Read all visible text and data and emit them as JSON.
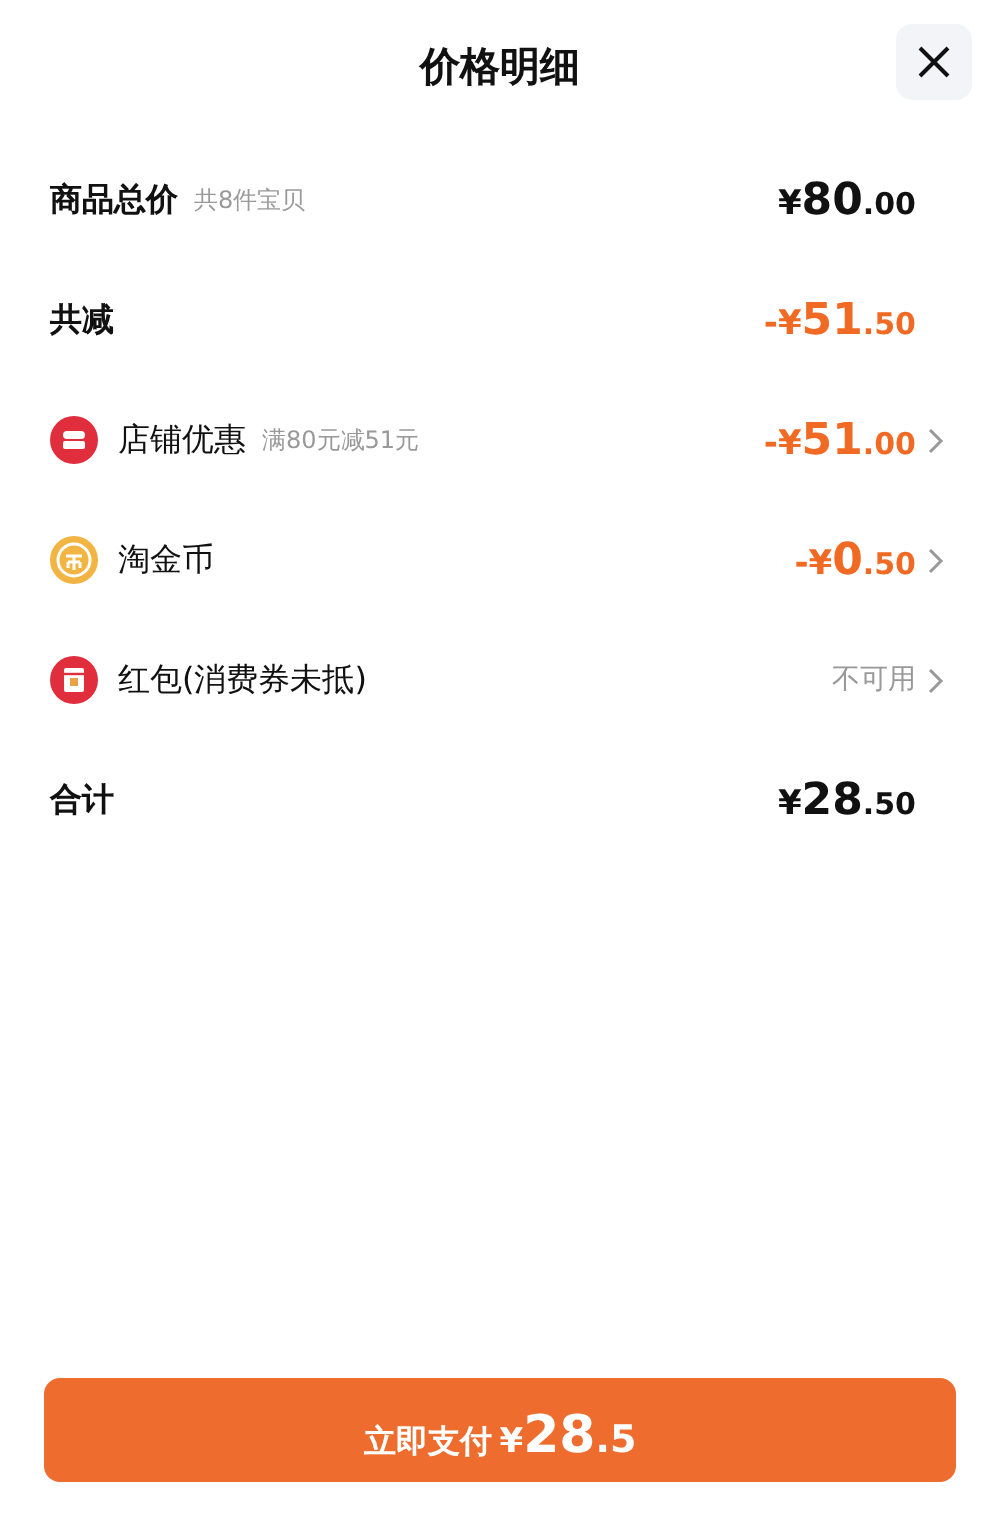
{
  "title": "价格明细",
  "rows": [
    {
      "kind": "summary",
      "label": "商品总价",
      "note": "共8件宝贝",
      "value": {
        "kind": "price",
        "currency": "¥",
        "integer": "80",
        "decimal": ".00"
      }
    },
    {
      "kind": "summary",
      "label": "共减",
      "value": {
        "kind": "price",
        "sign": "-",
        "currency": "¥",
        "integer": "51",
        "decimal": ".50"
      }
    },
    {
      "kind": "store",
      "label": "店铺优惠",
      "note": "满80元减51元",
      "value": {
        "kind": "price",
        "sign": "-",
        "currency": "¥",
        "integer": "51",
        "decimal": ".00"
      }
    },
    {
      "kind": "coin",
      "label": "淘金币",
      "value": {
        "kind": "price",
        "sign": "-",
        "currency": "¥",
        "integer": "0",
        "decimal": ".50"
      }
    },
    {
      "kind": "packet",
      "label": "红包(消费券未抵)",
      "value": {
        "kind": "text",
        "text": "不可用"
      }
    },
    {
      "kind": "summary",
      "label": "合计",
      "value": {
        "kind": "price",
        "currency": "¥",
        "integer": "28",
        "decimal": ".50"
      }
    }
  ],
  "pay_button": {
    "label": "立即支付",
    "currency": "¥",
    "integer": "28",
    "decimal": ".5"
  }
}
